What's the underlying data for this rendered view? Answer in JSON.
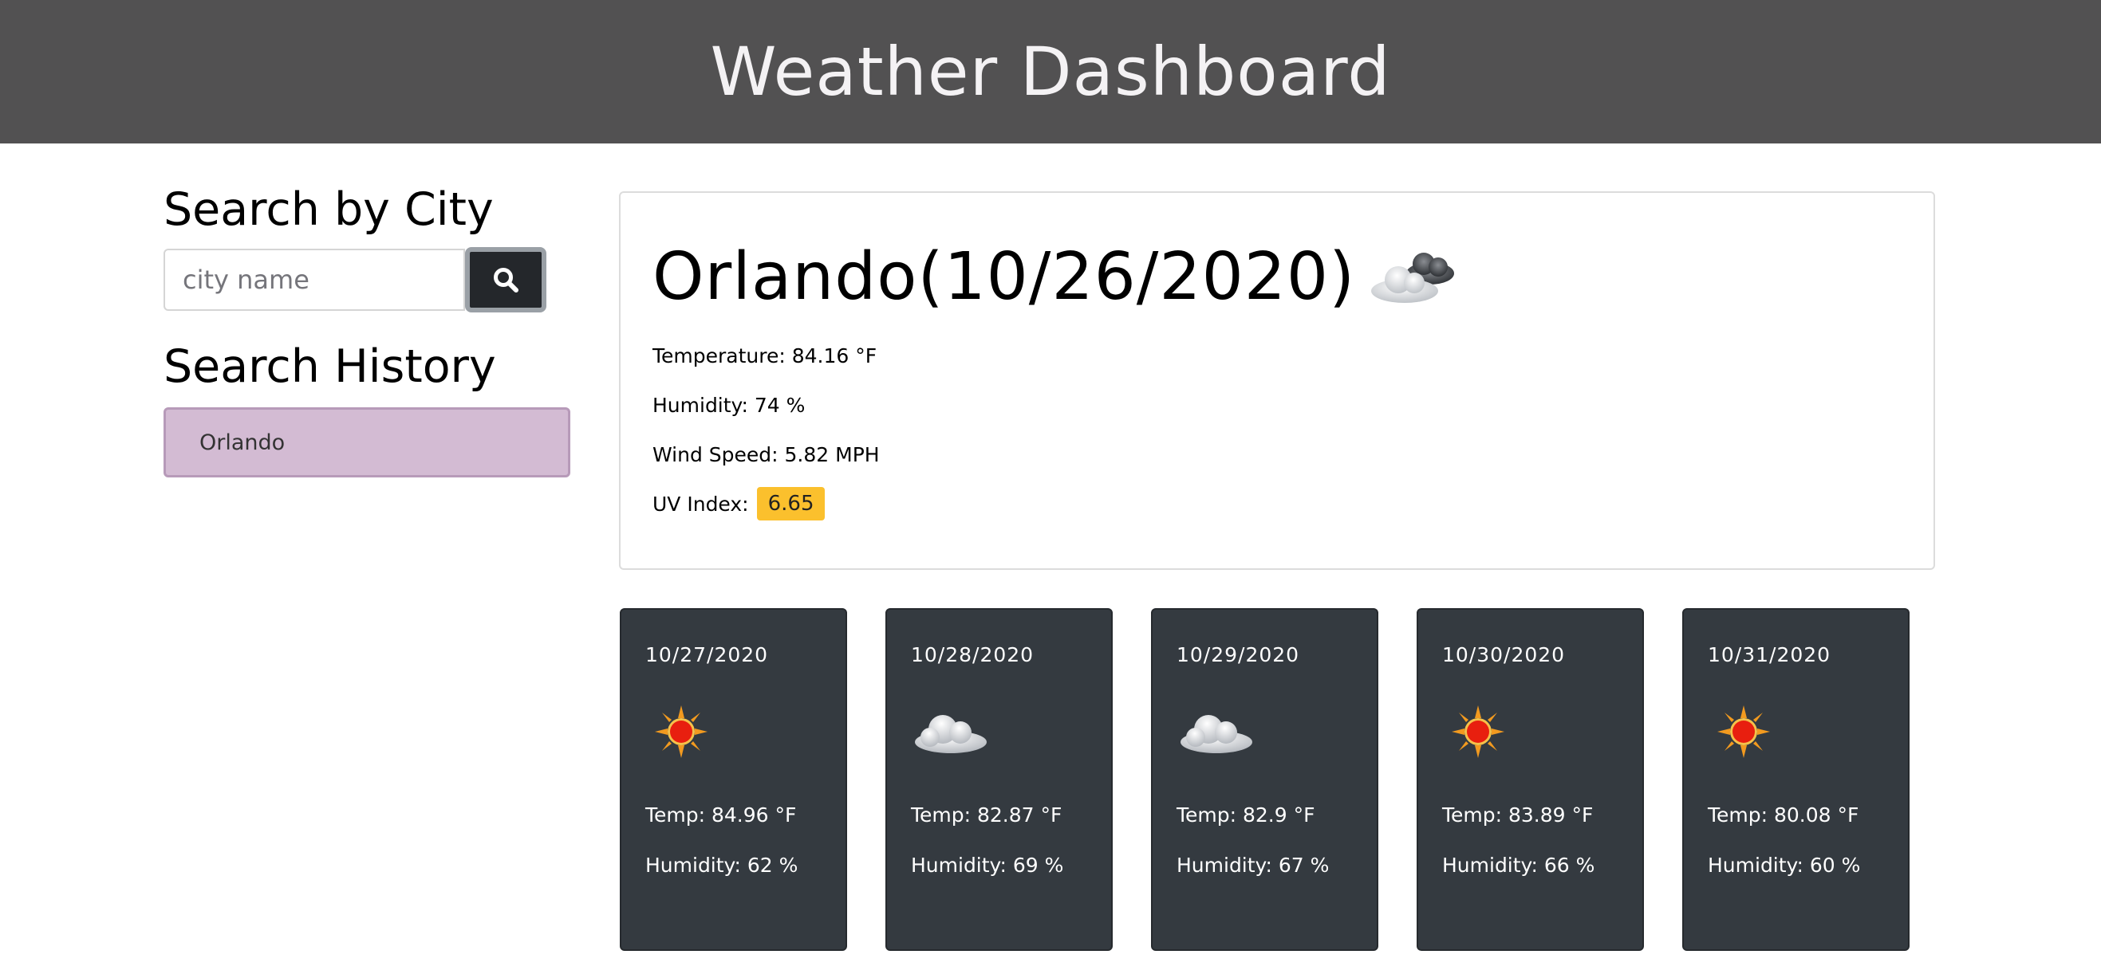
{
  "header": {
    "title": "Weather Dashboard"
  },
  "search": {
    "title": "Search by City",
    "placeholder": "city name",
    "button_icon": "search-icon"
  },
  "history": {
    "title": "Search History",
    "items": [
      "Orlando"
    ]
  },
  "current": {
    "title": "Orlando(10/26/2020)",
    "icon": "partly-cloudy-icon",
    "temperature": "Temperature: 84.16 °F",
    "humidity": "Humidity: 74 %",
    "wind": "Wind Speed: 5.82 MPH",
    "uv_label": "UV Index:",
    "uv_value": "6.65",
    "uv_color": "#fbc02d"
  },
  "forecast": [
    {
      "date": "10/27/2020",
      "icon": "sun-icon",
      "temp": "Temp: 84.96 °F",
      "humidity": "Humidity: 62 %"
    },
    {
      "date": "10/28/2020",
      "icon": "cloud-icon",
      "temp": "Temp: 82.87 °F",
      "humidity": "Humidity: 69 %"
    },
    {
      "date": "10/29/2020",
      "icon": "cloud-icon",
      "temp": "Temp: 82.9 °F",
      "humidity": "Humidity: 67 %"
    },
    {
      "date": "10/30/2020",
      "icon": "sun-icon",
      "temp": "Temp: 83.89 °F",
      "humidity": "Humidity: 66 %"
    },
    {
      "date": "10/31/2020",
      "icon": "sun-icon",
      "temp": "Temp: 80.08 °F",
      "humidity": "Humidity: 60 %"
    }
  ]
}
